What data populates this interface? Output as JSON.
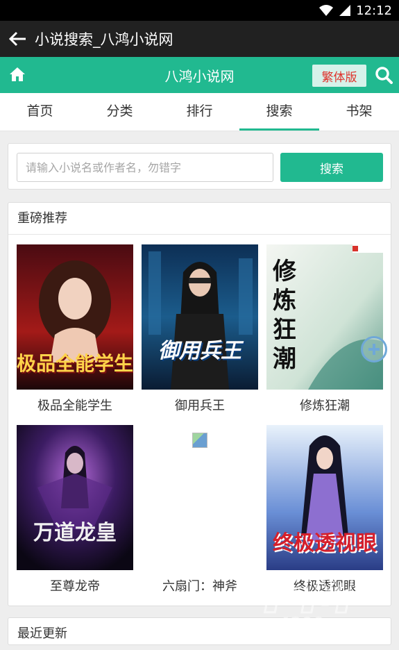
{
  "status": {
    "time": "12:12"
  },
  "appbar": {
    "title": "小说搜索_八鸿小说网"
  },
  "header": {
    "site_title": "八鸿小说网",
    "traditional_label": "繁体版"
  },
  "tabs": [
    {
      "label": "首页"
    },
    {
      "label": "分类"
    },
    {
      "label": "排行"
    },
    {
      "label": "搜索"
    },
    {
      "label": "书架"
    }
  ],
  "search": {
    "placeholder": "请输入小说名或作者名，勿错字",
    "button_label": "搜索"
  },
  "recommend": {
    "title": "重磅推荐",
    "books": [
      {
        "name": "极品全能学生",
        "cover_text": "极品全能学生"
      },
      {
        "name": "御用兵王",
        "cover_text": "御用兵王"
      },
      {
        "name": "修炼狂潮",
        "cover_text": "修炼狂潮"
      },
      {
        "name": "至尊龙帝",
        "cover_text": "万道龙皇"
      },
      {
        "name": "六扇门：神斧",
        "cover_text": ""
      },
      {
        "name": "终极透视眼",
        "cover_text": "终极透视眼"
      }
    ]
  },
  "recent": {
    "title": "最近更新"
  },
  "watermark": {
    "text": "FM 4399"
  },
  "colors": {
    "accent": "#21b990",
    "traditional_text": "#e0322b"
  }
}
